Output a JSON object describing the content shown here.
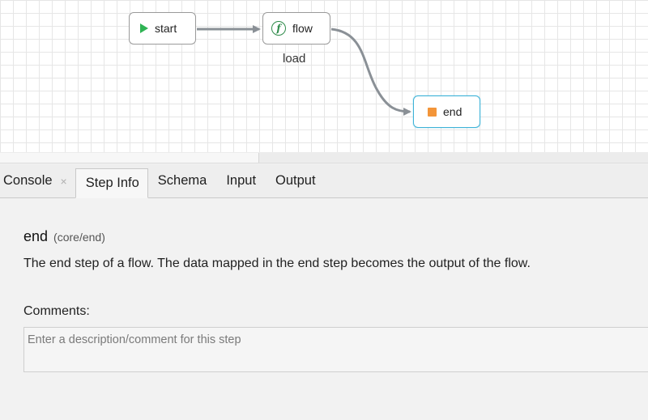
{
  "flow": {
    "nodes": {
      "start": {
        "label": "start"
      },
      "flow": {
        "label": "flow",
        "sublabel": "load"
      },
      "end": {
        "label": "end"
      }
    },
    "colors": {
      "start_icon": "#2fb354",
      "end_icon": "#f39539",
      "selected_border": "#3fb3d8",
      "edge": "#8a9096"
    }
  },
  "tabs": {
    "console": "Console",
    "console_close": "×",
    "step_info": "Step Info",
    "schema": "Schema",
    "input": "Input",
    "output": "Output"
  },
  "step_info": {
    "name": "end",
    "ref": "(core/end)",
    "description": "The end step of a flow. The data mapped in the end step becomes the output of the flow.",
    "comments_label": "Comments:",
    "comments_placeholder": "Enter a description/comment for this step",
    "comments_value": ""
  }
}
